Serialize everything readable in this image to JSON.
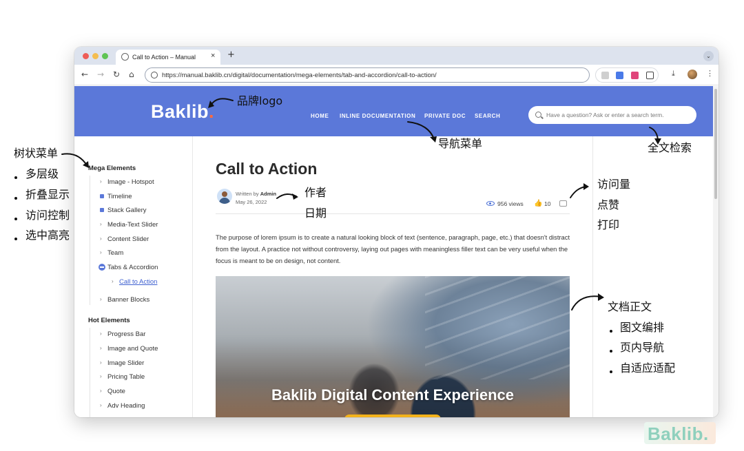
{
  "browser": {
    "tab_title": "Call to Action – Manual",
    "new_tab_label": "+",
    "url": "https://manual.baklib.cn/digital/documentation/mega-elements/tab-and-accordion/call-to-action/"
  },
  "site": {
    "logo_text": "Baklib",
    "logo_dot": ".",
    "nav": [
      "HOME",
      "INLINE DOCUMENTATION",
      "PRIVATE DOC",
      "SEARCH"
    ],
    "search_placeholder": "Have a question? Ask or enter a search term."
  },
  "sidebar": {
    "groups": [
      {
        "title": "Mega Elements",
        "items": [
          {
            "label": "Image - Hotspot",
            "marker": "chevron"
          },
          {
            "label": "Timeline",
            "marker": "lock"
          },
          {
            "label": "Stack Gallery",
            "marker": "lock"
          },
          {
            "label": "Media-Text Slider",
            "marker": "chevron"
          },
          {
            "label": "Content Slider",
            "marker": "chevron"
          },
          {
            "label": "Team",
            "marker": "chevron"
          },
          {
            "label": "Tabs & Accordion",
            "marker": "expanded"
          },
          {
            "label": "Call to Action",
            "marker": "chevron",
            "active": true,
            "level": 2
          },
          {
            "label": "Banner Blocks",
            "marker": "chevron"
          }
        ]
      },
      {
        "title": "Hot Elements",
        "items": [
          {
            "label": "Progress Bar"
          },
          {
            "label": "Image and Quote"
          },
          {
            "label": "Image Slider"
          },
          {
            "label": "Pricing Table"
          },
          {
            "label": "Quote"
          },
          {
            "label": "Adv Heading"
          }
        ]
      }
    ]
  },
  "article": {
    "title": "Call to Action",
    "written_by_label": "Written by",
    "author": "Admin",
    "date": "May 26, 2022",
    "views": "956 views",
    "likes": "10",
    "body": "The purpose of lorem ipsum is to create a natural looking block of text (sentence, paragraph, page, etc.) that doesn't distract from the layout. A practice not without controversy, laying out pages with meaningless filler text can be very useful when the focus is meant to be on design, not content.",
    "hero_title": "Baklib Digital Content Experience"
  },
  "annotations": {
    "brand_logo": "品牌logo",
    "nav_menu": "导航菜单",
    "full_text_search": "全文检索",
    "tree_menu": "树状菜单",
    "tree_features": [
      "多层级",
      "折叠显示",
      "访问控制",
      "选中高亮"
    ],
    "author": "作者",
    "date": "日期",
    "views": "访问量",
    "likes": "点赞",
    "print": "打印",
    "doc_body": "文档正文",
    "doc_features": [
      "图文编排",
      "页内导航",
      "自适应适配"
    ]
  },
  "watermark": {
    "text": "Baklib."
  },
  "colors": {
    "header_blue": "#5b78d9",
    "accent_orange": "#ff6a3d",
    "cta_yellow": "#f3b21b",
    "active_link": "#3d5fd0"
  }
}
